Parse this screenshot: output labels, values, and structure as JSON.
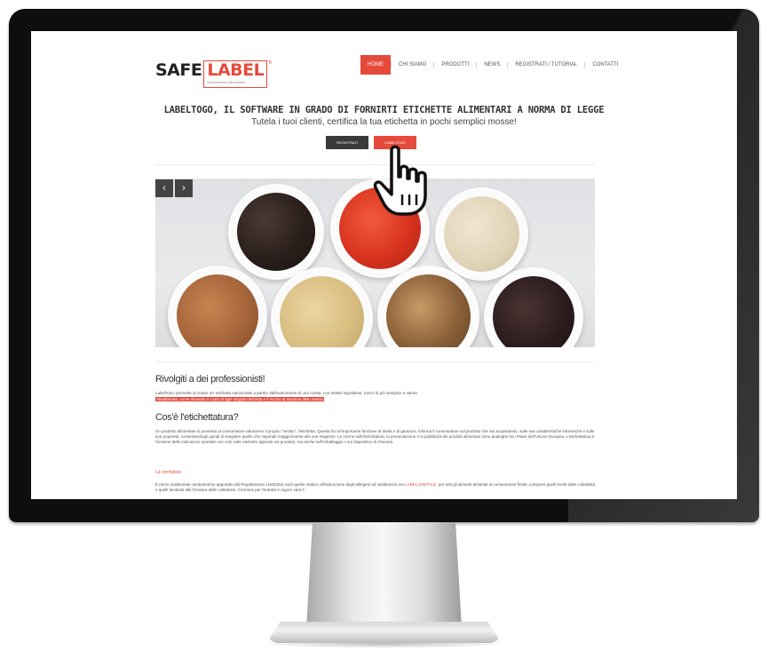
{
  "header": {
    "logo_safe": "SAFE",
    "logo_label": "LABEL",
    "logo_reg": "®",
    "logo_sub": "Nutriveterina Alimentare"
  },
  "nav": {
    "items": [
      {
        "label": "HOME",
        "active": true
      },
      {
        "label": "CHI SIAMO",
        "active": false
      },
      {
        "label": "PRODOTTI",
        "active": false
      },
      {
        "label": "NEWS",
        "active": false
      },
      {
        "label": "REGISTRATI / TUTORIAL",
        "active": false
      },
      {
        "label": "CONTATTI",
        "active": false
      }
    ]
  },
  "hero": {
    "title": "LABELTOGO, IL SOFTWARE IN GRADO DI FORNIRTI ETICHETTE ALIMENTARI A NORMA DI LEGGE",
    "subtitle": "Tutela i tuoi clienti, certifica la tua etichetta in pochi semplici mosse!",
    "btn_register": "REGISTRATI",
    "btn_try": "LABELTOGO"
  },
  "banner": {
    "prev_icon": "chevron-left-icon",
    "next_icon": "chevron-right-icon",
    "prev_label": "‹",
    "next_label": "›"
  },
  "content": {
    "heading1": "Rivolgiti a dei professionisti!",
    "para1": "LabelToGo permette di creare un' etichetta nutrizionale a partire dall'inserimento di una ricetta, con relativi ingredienti, mezzi di più semplice a valore",
    "para1_highlight": "Attualmente, come rilevante il costo di ogni singola etichetta e il rischio di sanzioni dello stesso",
    "heading2": "Cos'è l'etichettatura?",
    "para2": "Un prodotto alimentare si presenta al consumatore attraverso il proprio \"vestito\", l'etichetta. Questa ha un'importante funzione di tutela e di garanzia, informa il consumatore sul prodotto che sta acquistando, sulle sue caratteristiche intrinseche e sulle sue proprietà, consentendogli quindi di scegliere quello che risponde maggiormente alle sue esigenze. Le norme sull'etichettatura, la presentazione e la pubblicità dei prodotti alimentari sono analoghe tra i Paesi dell'Unione Europea. L'etichettatura è l'insieme delle indicazioni riportate non solo sulle etichette apposte sul prodotto, ma anche sull'imballaggio o sul dispositivo di chiusura.",
    "link_normativa": "La normativa",
    "para3_start": "È primo sostanziale cambiamento apportato dal Regolamento 1169/2011 sarà quello relativo all'indicazione degli allergeni ed intolleranze nei",
    "para3_red": "LABEL DIGITALE",
    "para3_end": ", per tutti gli alimenti destinati al consumatore finale, compresi quelli forniti dalle collettività e quelli destinati alla fornitura delle collettività. Il termine per l'entrata in vigore sarà il"
  }
}
